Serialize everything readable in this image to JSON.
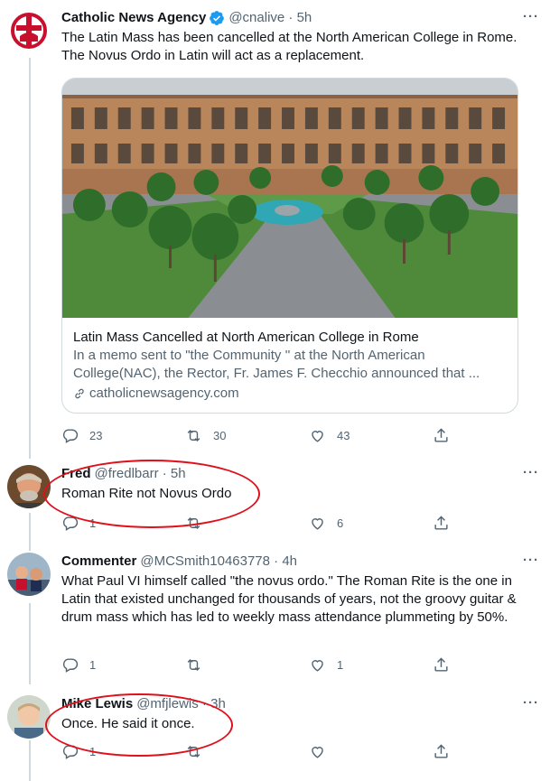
{
  "tweets": [
    {
      "name": "Catholic News Agency",
      "handle": "@cnalive · 5h",
      "text": "The Latin Mass has been cancelled at the North American College in Rome. The Novus Ordo in Latin will act as a replacement.",
      "card": {
        "title": "Latin Mass Cancelled at North American College in Rome",
        "desc": "In a memo sent to \"the Community '' at the North American College(NAC), the Rector, Fr. James F. Checchio announced that ...",
        "link": "catholicnewsagency.com"
      },
      "replies": "23",
      "retweets": "30",
      "likes": "43"
    },
    {
      "name": "Fred",
      "handle": "@fredlbarr · 5h",
      "text": "Roman Rite not Novus Ordo",
      "replies": "1",
      "retweets": "",
      "likes": "6"
    },
    {
      "name": "Commenter",
      "handle": "@MCSmith10463778 · 4h",
      "text": "What Paul VI himself called \"the novus ordo.\" The Roman Rite is the one in Latin that existed unchanged for thousands of years, not the groovy guitar & drum mass which has led to weekly mass attendance plummeting by 50%.",
      "replies": "1",
      "retweets": "",
      "likes": "1"
    },
    {
      "name": "Mike Lewis",
      "handle": "@mfjlewis · 3h",
      "text": "Once. He said it once.",
      "replies": "1",
      "retweets": "",
      "likes": ""
    }
  ],
  "more_label": "···",
  "colors": {
    "text": "#0f1419",
    "secondary": "#536471",
    "verified": "#1d9bf0",
    "annotation": "#e0101b"
  }
}
